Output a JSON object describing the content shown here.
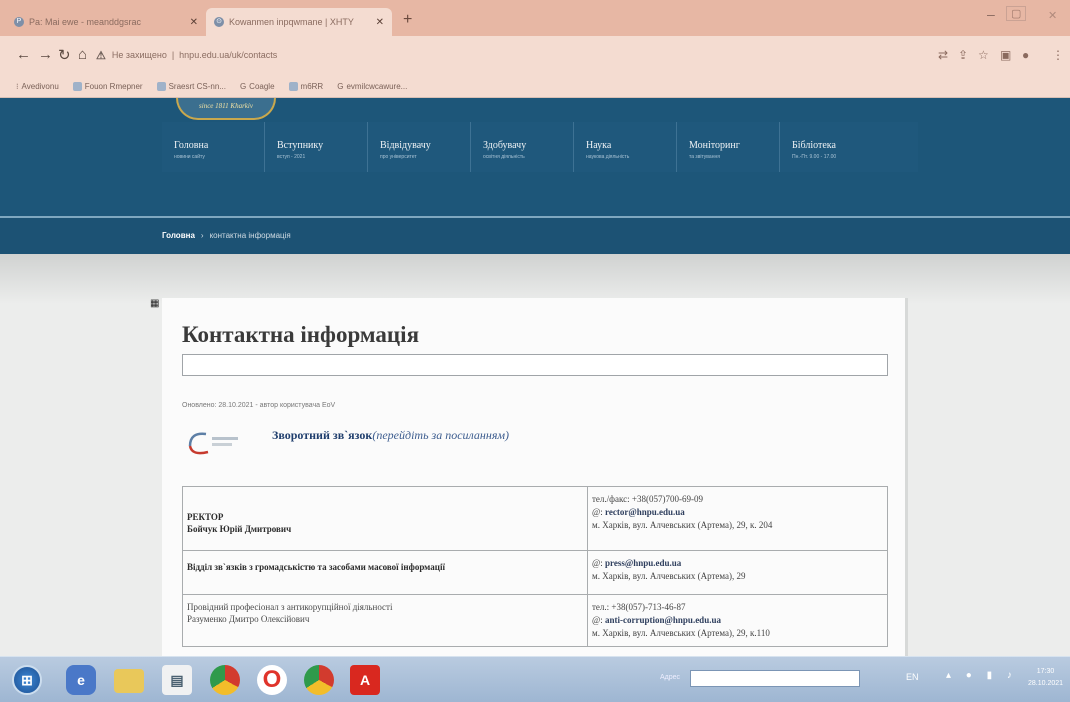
{
  "browser": {
    "tabs": [
      {
        "title": "Pa: Mai ewe - meanddgsrac",
        "active": false
      },
      {
        "title": "Kowanmen inpqwmane | XHTY",
        "active": true
      }
    ],
    "new_tab": "+",
    "window_controls": {
      "minimize": "‒",
      "maximize": "▢",
      "close": "✕"
    },
    "address_security": "Не захищено",
    "address_url": "hnpu.edu.ua/uk/contacts",
    "bookmarks": [
      "Avedivonu",
      "Fouon Rmepner",
      "Sraesrt CS-nn...",
      "Coagle",
      "m6RR",
      "evmilcwcawure..."
    ]
  },
  "site": {
    "logo_text": "since 1811 Kharkiv",
    "menu": [
      {
        "label": "Головна",
        "sub": "новини сайту"
      },
      {
        "label": "Вступнику",
        "sub": "вступ - 2021"
      },
      {
        "label": "Відвідувачу",
        "sub": "про університет"
      },
      {
        "label": "Здобувачу",
        "sub": "освітня діяльність"
      },
      {
        "label": "Наука",
        "sub": "наукова діяльність"
      },
      {
        "label": "Моніторинг",
        "sub": "та звітування"
      },
      {
        "label": "Бібліотека",
        "sub": "Пн.-Пт. 9.00 - 17.00"
      }
    ],
    "breadcrumb": {
      "home": "Головна",
      "separator": "›",
      "current": "контактна інформація"
    }
  },
  "content": {
    "title": "Контактна інформація",
    "updated": "Оновлено: 28.10.2021 - автор користувача EoV",
    "feedback_title": "Зворотний зв`язок",
    "feedback_link": "(перейдіть за посиланням)",
    "contacts": [
      {
        "position_bold": "РЕКТОР",
        "name_bold": "Бойчук Юрій Дмитрович",
        "phone": "тел./факс: +38(057)700-69-09",
        "email_prefix": "@:",
        "email": "rector@hnpu.edu.ua",
        "address": "м. Харків, вул. Алчевських (Артема), 29, к. 204"
      },
      {
        "position_bold": "Відділ зв`язків з громадськістю та засобами масової інформації",
        "email_prefix": "@:",
        "email": "press@hnpu.edu.ua",
        "address": "м. Харків, вул. Алчевських (Артема), 29"
      },
      {
        "position": "Провідний професіонал з антикорупційної діяльності",
        "name": "Разуменко Дмитро Олексійович",
        "phone": "тел.: +38(057)-713-46-87",
        "email_prefix": "@:",
        "email": "anti-corruption@hnpu.edu.ua",
        "address": "м. Харків, вул. Алчевських (Артема), 29, к.110"
      }
    ]
  },
  "taskbar": {
    "address_label": "Адрес",
    "lang": "EN",
    "time": "17:30",
    "date": "28.10.2021"
  },
  "colors": {
    "header_blue": "#1d5679",
    "tab_bar": "#e7b7a4",
    "toolbar": "#f4dcd1"
  }
}
